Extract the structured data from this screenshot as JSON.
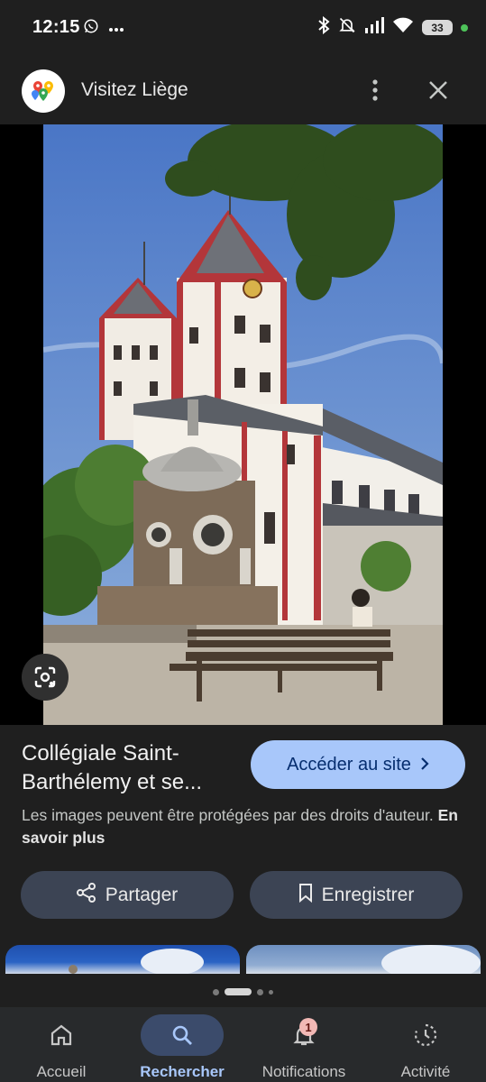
{
  "status_bar": {
    "time": "12:15",
    "battery": "33",
    "left_icons": [
      "whatsapp-icon",
      "more-notifications-icon"
    ],
    "right_icons": [
      "bluetooth-icon",
      "mute-icon",
      "signal-icon",
      "wifi-icon",
      "battery-icon"
    ]
  },
  "header": {
    "title": "Visitez Liège",
    "logo_icon": "google-maps-icon",
    "menu_icon": "more-vert-icon",
    "close_icon": "close-icon"
  },
  "image": {
    "lens_icon": "google-lens-icon"
  },
  "details": {
    "title": "Collégiale Saint-Barthélemy et se...",
    "visit_label": "Accéder au site",
    "copyright_text": "Les images peuvent être protégées par des droits d'auteur.",
    "learn_more": "En savoir plus",
    "share_label": "Partager",
    "save_label": "Enregistrer"
  },
  "pager": {
    "active_index": 1,
    "count": 4
  },
  "bottom_nav": {
    "items": [
      {
        "label": "Accueil",
        "icon": "home-icon",
        "active": false
      },
      {
        "label": "Rechercher",
        "icon": "search-icon",
        "active": true
      },
      {
        "label": "Notifications",
        "icon": "bell-icon",
        "active": false,
        "badge": "1"
      },
      {
        "label": "Activité",
        "icon": "activity-icon",
        "active": false
      }
    ]
  },
  "colors": {
    "background": "#1f1f1f",
    "accent": "#a8c7fa",
    "secondary_button": "#3c4454",
    "nav_background": "#282a2c"
  }
}
